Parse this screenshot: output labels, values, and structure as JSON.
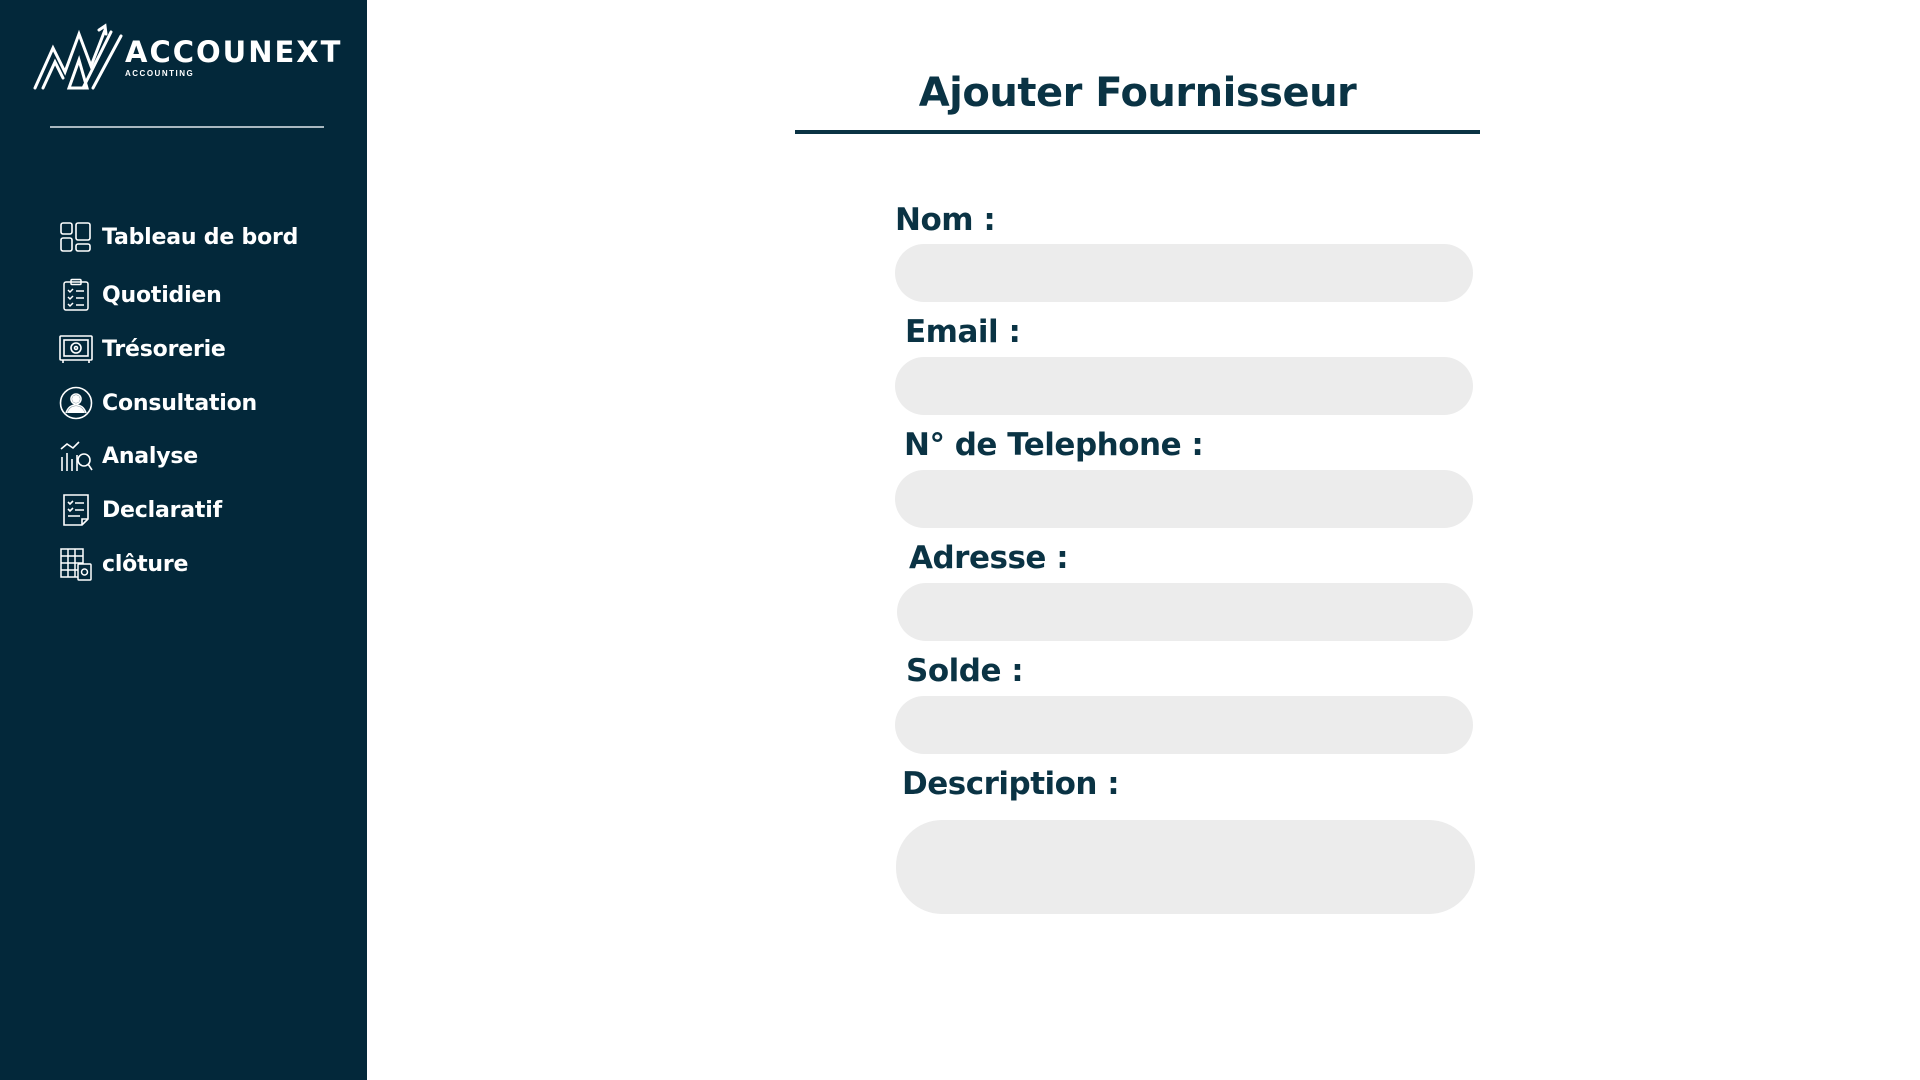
{
  "brand": {
    "name": "ACCOUNEXT",
    "tagline": "ACCOUNTING",
    "colors": {
      "sidebar": "#03283a",
      "heading": "#0a3344",
      "input_bg": "#ececec"
    }
  },
  "sidebar": {
    "items": [
      {
        "label": "Tableau de bord",
        "icon": "dashboard-icon"
      },
      {
        "label": "Quotidien",
        "icon": "clipboard-checklist-icon"
      },
      {
        "label": "Trésorerie",
        "icon": "safe-icon"
      },
      {
        "label": "Consultation",
        "icon": "user-circle-icon"
      },
      {
        "label": "Analyse",
        "icon": "analytics-chart-icon"
      },
      {
        "label": "Declaratif",
        "icon": "document-checklist-icon"
      },
      {
        "label": "clôture",
        "icon": "ledger-calculator-icon"
      }
    ]
  },
  "form": {
    "title": "Ajouter Fournisseur",
    "fields": [
      {
        "label": "Nom :",
        "value": ""
      },
      {
        "label": "Email :",
        "value": ""
      },
      {
        "label": "N° de Telephone :",
        "value": ""
      },
      {
        "label": "Adresse :",
        "value": ""
      },
      {
        "label": "Solde :",
        "value": ""
      },
      {
        "label": "Description :",
        "value": ""
      }
    ]
  }
}
